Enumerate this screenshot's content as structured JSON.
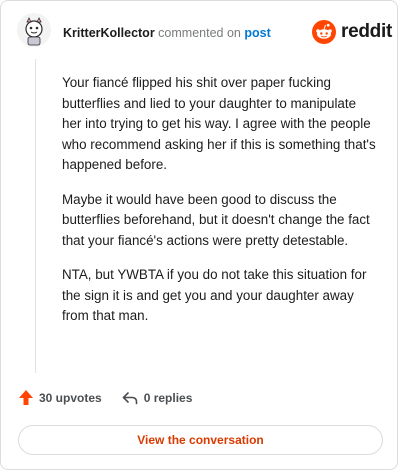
{
  "header": {
    "username": "KritterKollector",
    "action": "commented on",
    "post_link": "post",
    "brand": "reddit"
  },
  "comment": {
    "paragraphs": [
      "Your fiancé flipped his shit over paper fucking butterflies and lied to your daughter to manipulate her into trying to get his way. I agree with the people who recommend asking her if this is something that's happened before.",
      "Maybe it would have been good to discuss the butterflies beforehand, but it doesn't change the fact that your fiancé's actions were pretty detestable.",
      "NTA, but YWBTA if you do not take this situation for the sign it is and get you and your daughter away from that man."
    ]
  },
  "stats": {
    "upvotes": "30 upvotes",
    "replies": "0 replies"
  },
  "footer": {
    "view_button": "View the conversation"
  },
  "colors": {
    "brand_orange": "#ff4500",
    "upvote_orange": "#ff4500",
    "link_blue": "#0079d3",
    "button_text": "#d93a00"
  },
  "icons": {
    "avatar": "user-avatar-icon",
    "brand": "reddit-logo-icon",
    "upvote": "upvote-arrow-icon",
    "reply": "reply-arrow-icon"
  }
}
